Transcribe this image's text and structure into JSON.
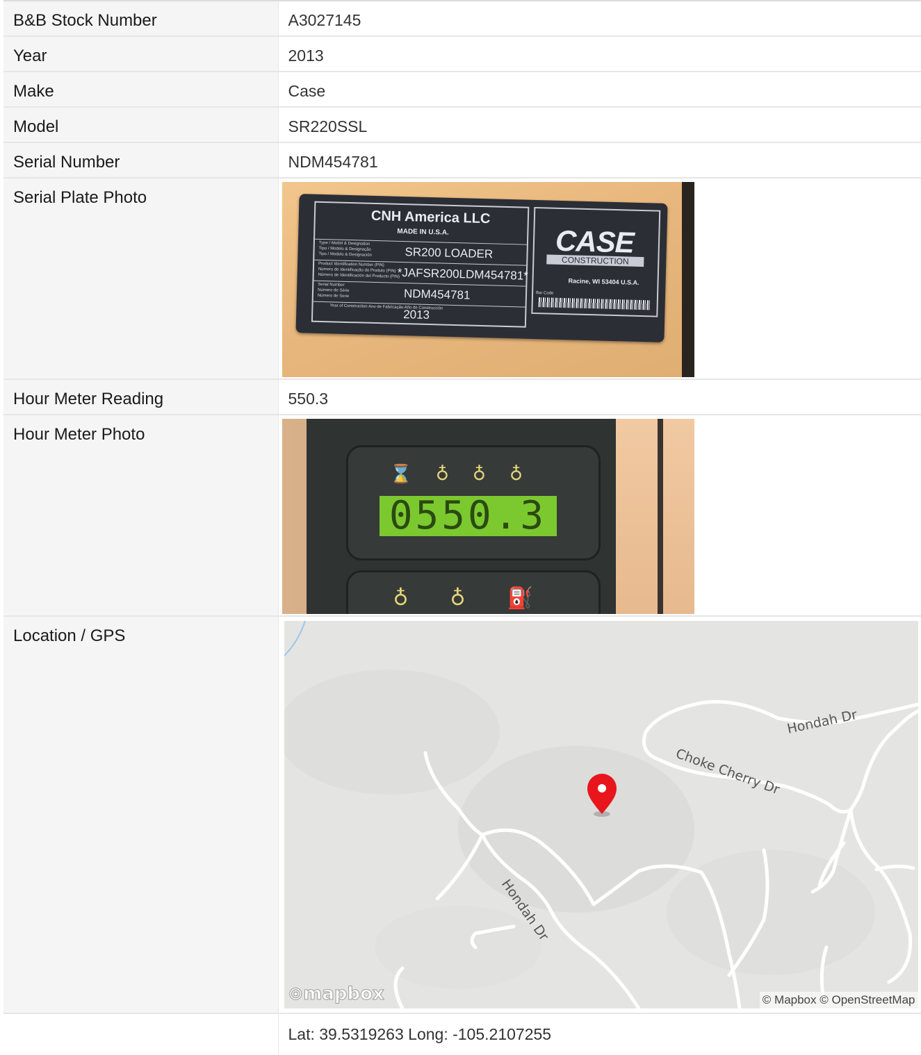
{
  "rows": [
    {
      "label": "B&B Stock Number",
      "value": "A3027145"
    },
    {
      "label": "Year",
      "value": "2013"
    },
    {
      "label": "Make",
      "value": "Case"
    },
    {
      "label": "Model",
      "value": "SR220SSL"
    },
    {
      "label": "Serial Number",
      "value": "NDM454781"
    },
    {
      "label": "Serial Plate Photo"
    },
    {
      "label": "Hour Meter Reading",
      "value": "550.3"
    },
    {
      "label": "Hour Meter Photo"
    },
    {
      "label": "Location / GPS"
    }
  ],
  "serial_plate": {
    "company": "CNH America LLC",
    "made_in": "MADE IN U.S.A.",
    "type_label": "Type / Model & Designation\nTipo / Modelo & Designação\nTipo / Modelo & Designación",
    "type_value": "SR200 LOADER",
    "pin_label": "Product Identification Number (PIN)\nNúmero de Identificação do Produto (PIN)\nNúmero de Identificación del Producto (PIN)",
    "pin_value": "*JAFSR200LDM454781*",
    "serial_label": "Serial Number\nNúmero de Série\nNúmero de Serie",
    "serial_value": "NDM454781",
    "year_label": "Year of Construction\nAno de Fabricação\nAño de Construcción",
    "year_value": "2013",
    "brand": "CASE",
    "brand_sub": "CONSTRUCTION",
    "address": "Racine, WI 53404 U.S.A.",
    "barcode_label": "Bar Code"
  },
  "hour_meter": {
    "display": "0550.3",
    "icon": "hourglass-icon"
  },
  "map": {
    "roads": [
      "Hondah Dr",
      "Choke Cherry Dr",
      "Hondah Dr"
    ],
    "logo": "mapbox",
    "attribution": "© Mapbox © OpenStreetMap",
    "marker_color": "#e8161c"
  },
  "coordinates": "Lat: 39.5319263 Long: -105.2107255"
}
